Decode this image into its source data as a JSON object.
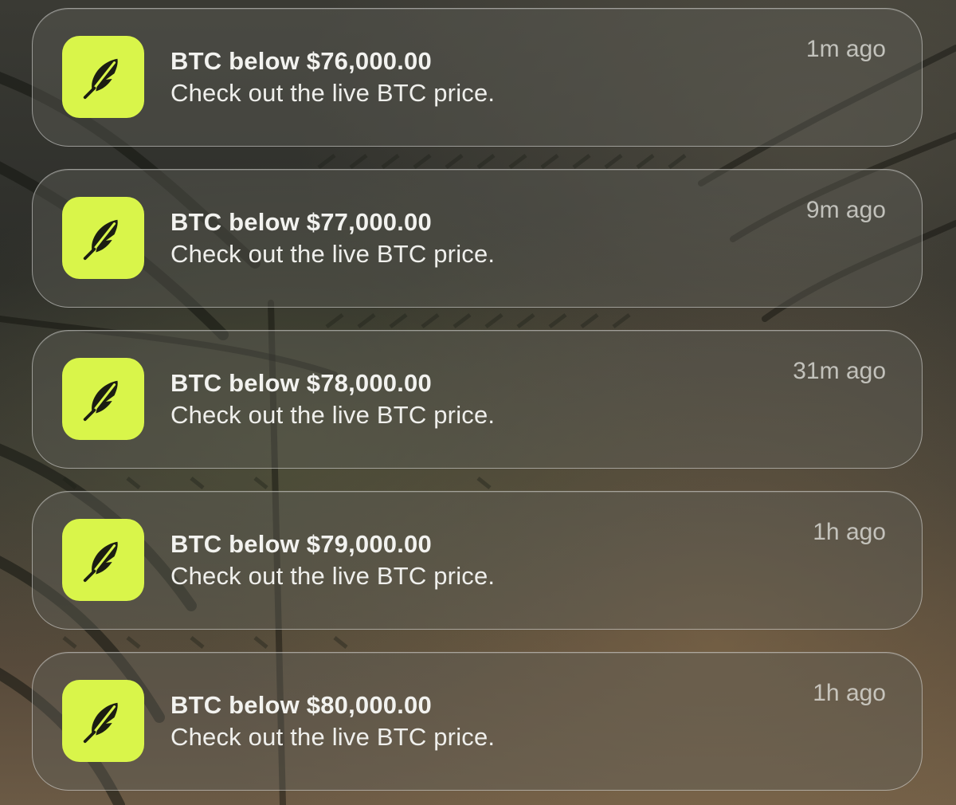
{
  "app": {
    "icon_name": "robinhood-feather-icon",
    "icon_bg_color": "#d9f54a",
    "icon_fg_color": "#1b1d12"
  },
  "notifications": [
    {
      "title": "BTC below $76,000.00",
      "body": "Check out the live BTC price.",
      "time": "1m ago"
    },
    {
      "title": "BTC below $77,000.00",
      "body": "Check out the live BTC price.",
      "time": "9m ago"
    },
    {
      "title": "BTC below $78,000.00",
      "body": "Check out the live BTC price.",
      "time": "31m ago"
    },
    {
      "title": "BTC below $79,000.00",
      "body": "Check out the live BTC price.",
      "time": "1h ago"
    },
    {
      "title": "BTC below $80,000.00",
      "body": "Check out the live BTC price.",
      "time": "1h ago"
    }
  ]
}
